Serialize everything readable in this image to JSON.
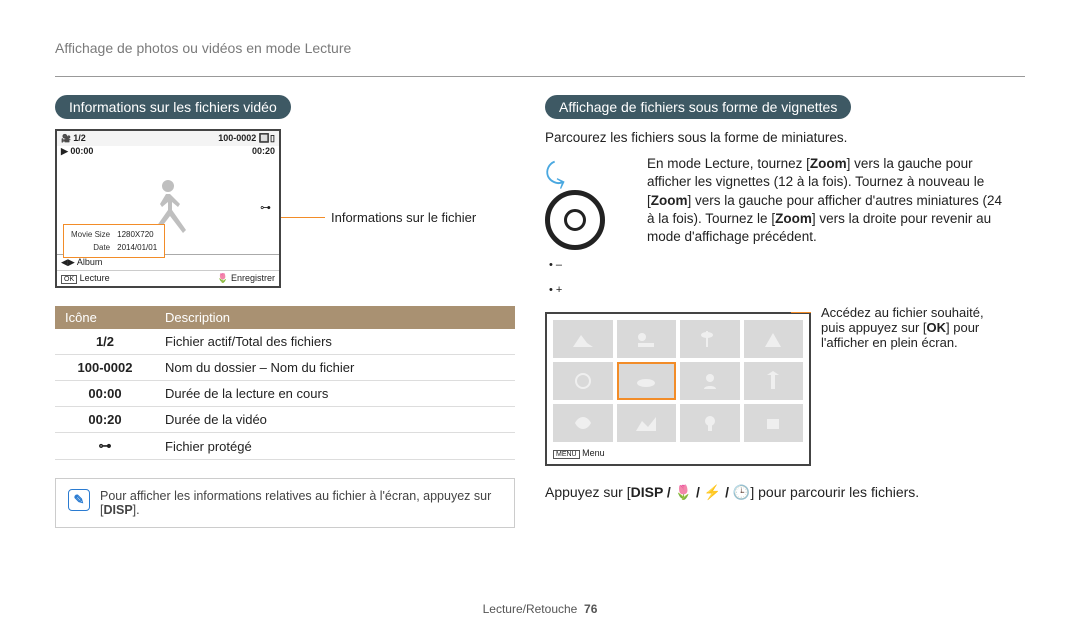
{
  "breadcrumb": "Affichage de photos ou vidéos en mode Lecture",
  "left": {
    "heading": "Informations sur les fichiers vidéo",
    "screen": {
      "file_index": "1/2",
      "folder_file": "100-0002",
      "elapsed": "00:00",
      "total": "00:20",
      "info_rows": [
        {
          "k": "Movie Size",
          "v": "1280X720"
        },
        {
          "k": "Date",
          "v": "2014/01/01"
        }
      ],
      "album": "Album",
      "play": "Lecture",
      "save": "Enregistrer"
    },
    "callout": "Informations sur le fichier",
    "table": {
      "hdr_icon": "Icône",
      "hdr_desc": "Description",
      "rows": [
        {
          "ic": "1/2",
          "desc": "Fichier actif/Total des fichiers"
        },
        {
          "ic": "100-0002",
          "desc": "Nom du dossier – Nom du fichier"
        },
        {
          "ic": "00:00",
          "desc": "Durée de la lecture en cours"
        },
        {
          "ic": "00:20",
          "desc": "Durée de la vidéo"
        },
        {
          "ic": "⊶",
          "desc": "Fichier protégé"
        }
      ]
    },
    "note": "Pour afficher les informations relatives au fichier à l'écran, appuyez sur [",
    "note_btn": "DISP",
    "note_end": "]."
  },
  "right": {
    "heading": "Affichage de fichiers sous forme de vignettes",
    "intro": "Parcourez les fichiers sous la forme de miniatures.",
    "zoom_text_1": "En mode Lecture, tournez [",
    "zoom_b1": "Zoom",
    "zoom_text_2": "] vers la gauche pour afficher les vignettes (12 à la fois). Tournez à nouveau le [",
    "zoom_b2": "Zoom",
    "zoom_text_3": "] vers la gauche pour afficher d'autres miniatures (24 à la fois). Tournez le [",
    "zoom_b3": "Zoom",
    "zoom_text_4": "] vers la droite pour revenir au mode d'affichage précédent.",
    "dots_minus": "• –",
    "dots_plus": "• +",
    "menu_label": "Menu",
    "menu_btn": "MENU",
    "thumbs_callout_1": "Accédez au fichier souhaité, puis appuyez sur [",
    "thumbs_btn": "OK",
    "thumbs_callout_2": "] pour l'afficher en plein écran.",
    "press": "Appuyez sur [",
    "press_btns": "DISP / 🌷 / ⚡ / 🕒",
    "press_end": "] pour parcourir les fichiers."
  },
  "footer": {
    "section": "Lecture/Retouche",
    "page": "76"
  }
}
